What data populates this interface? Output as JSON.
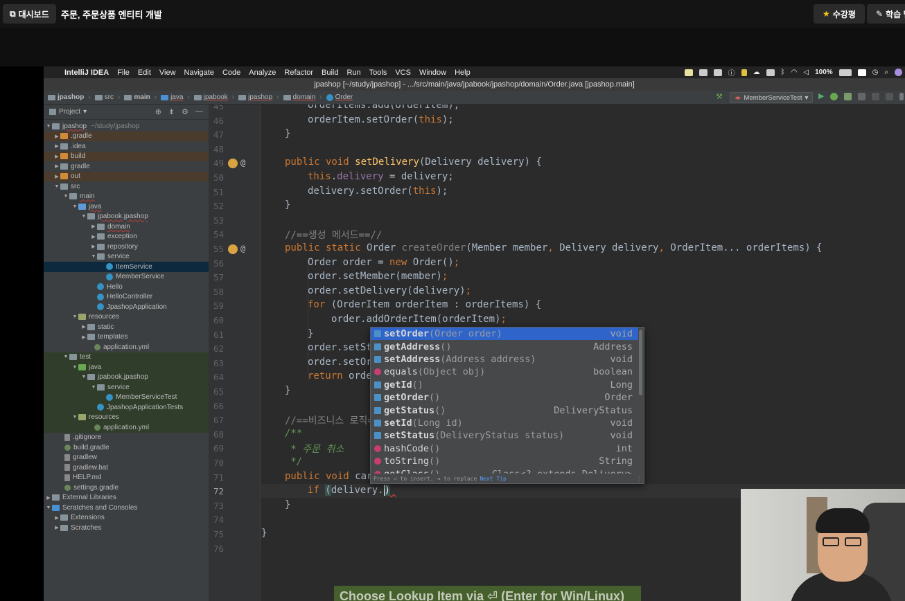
{
  "course": {
    "dashboard_label": "대시보드",
    "lecture_title": "주문, 주문상품 엔티티 개발",
    "review_label": "수강평",
    "note_label": "학습 맵"
  },
  "macmenu": {
    "app": "IntelliJ IDEA",
    "items": [
      "File",
      "Edit",
      "View",
      "Navigate",
      "Code",
      "Analyze",
      "Refactor",
      "Build",
      "Run",
      "Tools",
      "VCS",
      "Window",
      "Help"
    ],
    "battery": "100%"
  },
  "window_title": "jpashop [~/study/jpashop] - .../src/main/java/jpabook/jpashop/domain/Order.java [jpashop.main]",
  "breadcrumbs": [
    "jpashop",
    "src",
    "main",
    "java",
    "jpabook",
    "jpashop",
    "domain",
    "Order"
  ],
  "run_config": "MemberServiceTest",
  "project": {
    "header": "Project",
    "root": "jpashop",
    "root_path": "~/study/jpashop",
    "tree": [
      ".gradle",
      ".idea",
      "build",
      "gradle",
      "out",
      "src",
      "main",
      "java",
      "jpabook.jpashop",
      "domain",
      "exception",
      "repository",
      "service",
      "ItemService",
      "MemberService",
      "Hello",
      "HelloController",
      "JpashopApplication",
      "resources",
      "static",
      "templates",
      "application.yml",
      "test",
      "java",
      "jpabook.jpashop",
      "service",
      "MemberServiceTest",
      "JpashopApplicationTests",
      "resources",
      "application.yml",
      ".gitignore",
      "build.gradle",
      "gradlew",
      "gradlew.bat",
      "HELP.md",
      "settings.gradle",
      "External Libraries",
      "Scratches and Consoles",
      "Extensions",
      "Scratches"
    ]
  },
  "editor": {
    "line_numbers": [
      "45",
      "46",
      "47",
      "48",
      "49",
      "50",
      "51",
      "52",
      "53",
      "54",
      "55",
      "56",
      "57",
      "58",
      "59",
      "60",
      "61",
      "62",
      "63",
      "64",
      "65",
      "66",
      "67",
      "68",
      "69",
      "70",
      "71",
      "72",
      "73",
      "74",
      "75",
      "76"
    ],
    "comment_create": "//==생성 메서드==//",
    "comment_biz": "//==비즈니스 로직=",
    "doc_cancel": " * 주문 취소"
  },
  "completion": {
    "items": [
      {
        "name": "setOrder",
        "params": "(Order order)",
        "type": "void"
      },
      {
        "name": "getAddress",
        "params": "()",
        "type": "Address"
      },
      {
        "name": "setAddress",
        "params": "(Address address)",
        "type": "void"
      },
      {
        "name": "equals",
        "params": "(Object obj)",
        "type": "boolean"
      },
      {
        "name": "getId",
        "params": "()",
        "type": "Long"
      },
      {
        "name": "getOrder",
        "params": "()",
        "type": "Order"
      },
      {
        "name": "getStatus",
        "params": "()",
        "type": "DeliveryStatus"
      },
      {
        "name": "setId",
        "params": "(Long id)",
        "type": "void"
      },
      {
        "name": "setStatus",
        "params": "(DeliveryStatus status)",
        "type": "void"
      },
      {
        "name": "hashCode",
        "params": "()",
        "type": "int"
      },
      {
        "name": "toString",
        "params": "()",
        "type": "String"
      },
      {
        "name": "getClass",
        "params": "()",
        "type": "Class<? extends Delivery>"
      }
    ],
    "footer_press": "Press ⏎ to insert, ⇥ to replace",
    "footer_tip": "Next Tip"
  },
  "toast": "Choose Lookup Item via ⏎ (Enter for Win/Linux)"
}
